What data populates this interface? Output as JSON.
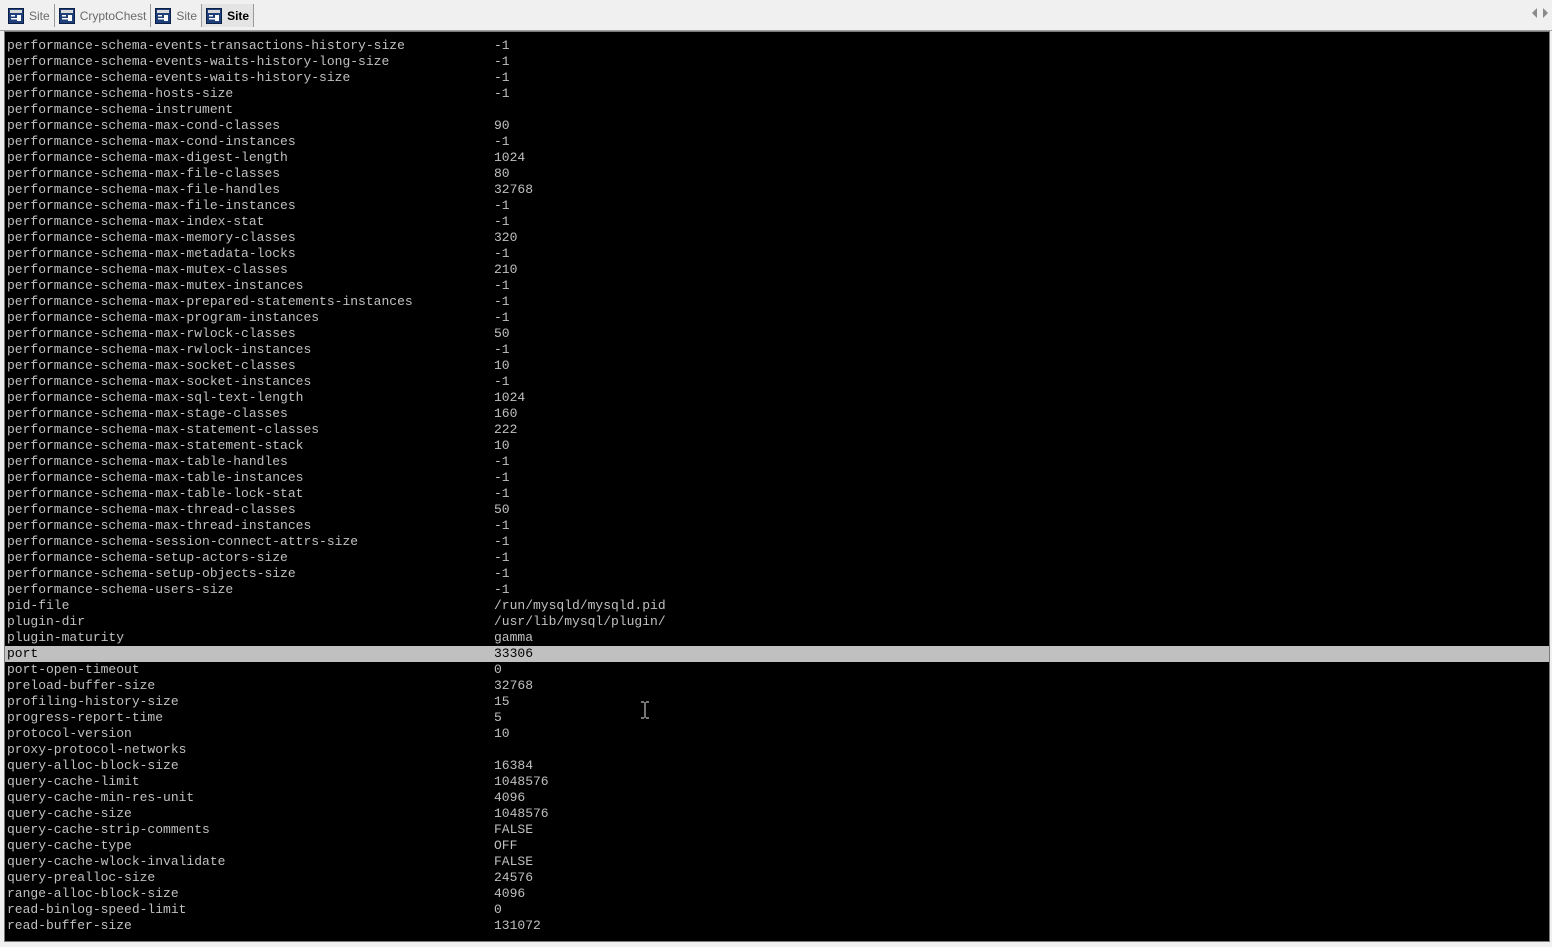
{
  "tabs": [
    {
      "label": "Site",
      "active": false,
      "icon": "terminal-app-icon"
    },
    {
      "label": "CryptoChest",
      "active": false,
      "icon": "terminal-app-icon"
    },
    {
      "label": "Site",
      "active": false,
      "icon": "terminal-app-icon"
    },
    {
      "label": "Site",
      "active": true,
      "icon": "terminal-app-icon"
    }
  ],
  "colors": {
    "terminal_bg": "#000000",
    "terminal_fg": "#c0c0c0",
    "selection_bg": "#c0c0c0",
    "selection_fg": "#000000",
    "icon_blue": "#1f3f7a"
  },
  "terminal": {
    "selected_row_key": "port",
    "rows": [
      {
        "key": "performance-schema-events-transactions-history-size",
        "value": "-1"
      },
      {
        "key": "performance-schema-events-waits-history-long-size",
        "value": "-1"
      },
      {
        "key": "performance-schema-events-waits-history-size",
        "value": "-1"
      },
      {
        "key": "performance-schema-hosts-size",
        "value": "-1"
      },
      {
        "key": "performance-schema-instrument",
        "value": ""
      },
      {
        "key": "performance-schema-max-cond-classes",
        "value": "90"
      },
      {
        "key": "performance-schema-max-cond-instances",
        "value": "-1"
      },
      {
        "key": "performance-schema-max-digest-length",
        "value": "1024"
      },
      {
        "key": "performance-schema-max-file-classes",
        "value": "80"
      },
      {
        "key": "performance-schema-max-file-handles",
        "value": "32768"
      },
      {
        "key": "performance-schema-max-file-instances",
        "value": "-1"
      },
      {
        "key": "performance-schema-max-index-stat",
        "value": "-1"
      },
      {
        "key": "performance-schema-max-memory-classes",
        "value": "320"
      },
      {
        "key": "performance-schema-max-metadata-locks",
        "value": "-1"
      },
      {
        "key": "performance-schema-max-mutex-classes",
        "value": "210"
      },
      {
        "key": "performance-schema-max-mutex-instances",
        "value": "-1"
      },
      {
        "key": "performance-schema-max-prepared-statements-instances",
        "value": "-1"
      },
      {
        "key": "performance-schema-max-program-instances",
        "value": "-1"
      },
      {
        "key": "performance-schema-max-rwlock-classes",
        "value": "50"
      },
      {
        "key": "performance-schema-max-rwlock-instances",
        "value": "-1"
      },
      {
        "key": "performance-schema-max-socket-classes",
        "value": "10"
      },
      {
        "key": "performance-schema-max-socket-instances",
        "value": "-1"
      },
      {
        "key": "performance-schema-max-sql-text-length",
        "value": "1024"
      },
      {
        "key": "performance-schema-max-stage-classes",
        "value": "160"
      },
      {
        "key": "performance-schema-max-statement-classes",
        "value": "222"
      },
      {
        "key": "performance-schema-max-statement-stack",
        "value": "10"
      },
      {
        "key": "performance-schema-max-table-handles",
        "value": "-1"
      },
      {
        "key": "performance-schema-max-table-instances",
        "value": "-1"
      },
      {
        "key": "performance-schema-max-table-lock-stat",
        "value": "-1"
      },
      {
        "key": "performance-schema-max-thread-classes",
        "value": "50"
      },
      {
        "key": "performance-schema-max-thread-instances",
        "value": "-1"
      },
      {
        "key": "performance-schema-session-connect-attrs-size",
        "value": "-1"
      },
      {
        "key": "performance-schema-setup-actors-size",
        "value": "-1"
      },
      {
        "key": "performance-schema-setup-objects-size",
        "value": "-1"
      },
      {
        "key": "performance-schema-users-size",
        "value": "-1"
      },
      {
        "key": "pid-file",
        "value": "/run/mysqld/mysqld.pid"
      },
      {
        "key": "plugin-dir",
        "value": "/usr/lib/mysql/plugin/"
      },
      {
        "key": "plugin-maturity",
        "value": "gamma"
      },
      {
        "key": "port",
        "value": "33306"
      },
      {
        "key": "port-open-timeout",
        "value": "0"
      },
      {
        "key": "preload-buffer-size",
        "value": "32768"
      },
      {
        "key": "profiling-history-size",
        "value": "15"
      },
      {
        "key": "progress-report-time",
        "value": "5"
      },
      {
        "key": "protocol-version",
        "value": "10"
      },
      {
        "key": "proxy-protocol-networks",
        "value": ""
      },
      {
        "key": "query-alloc-block-size",
        "value": "16384"
      },
      {
        "key": "query-cache-limit",
        "value": "1048576"
      },
      {
        "key": "query-cache-min-res-unit",
        "value": "4096"
      },
      {
        "key": "query-cache-size",
        "value": "1048576"
      },
      {
        "key": "query-cache-strip-comments",
        "value": "FALSE"
      },
      {
        "key": "query-cache-type",
        "value": "OFF"
      },
      {
        "key": "query-cache-wlock-invalidate",
        "value": "FALSE"
      },
      {
        "key": "query-prealloc-size",
        "value": "24576"
      },
      {
        "key": "range-alloc-block-size",
        "value": "4096"
      },
      {
        "key": "read-binlog-speed-limit",
        "value": "0"
      },
      {
        "key": "read-buffer-size",
        "value": "131072"
      }
    ]
  }
}
